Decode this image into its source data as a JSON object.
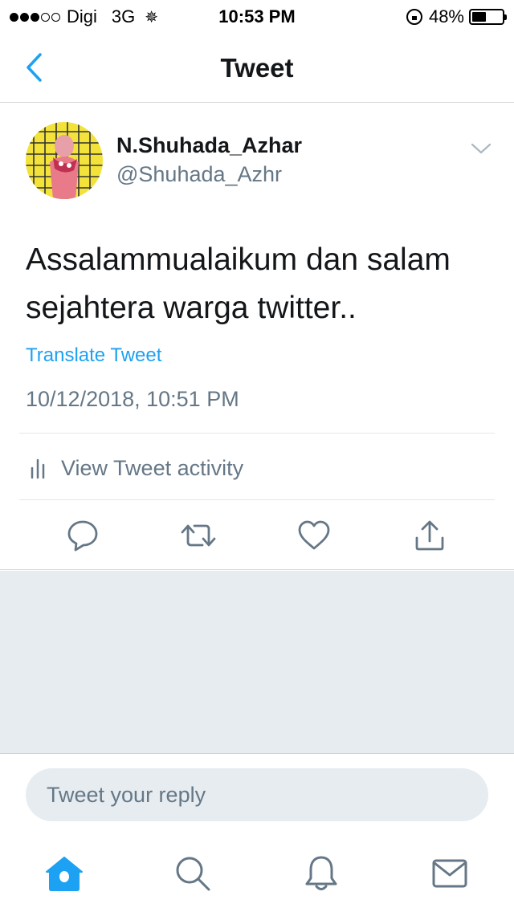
{
  "status_bar": {
    "carrier": "Digi",
    "network": "3G",
    "time": "10:53 PM",
    "battery": "48%",
    "battery_level": 0.48,
    "signal_bars_filled": 3,
    "signal_bars_total": 5
  },
  "nav": {
    "title": "Tweet",
    "back_icon": "chevron-left-icon"
  },
  "tweet": {
    "display_name": "N.Shuhada_Azhar",
    "username": "@Shuhada_Azhr",
    "text": "Assalammualaikum dan salam sejahtera warga twitter..",
    "translate_label": "Translate Tweet",
    "timestamp": "10/12/2018, 10:51 PM",
    "activity_label": "View Tweet activity"
  },
  "actions": [
    {
      "name": "reply",
      "icon": "comment-icon"
    },
    {
      "name": "retweet",
      "icon": "retweet-icon"
    },
    {
      "name": "like",
      "icon": "heart-icon"
    },
    {
      "name": "share",
      "icon": "share-icon"
    }
  ],
  "reply_box": {
    "placeholder": "Tweet your reply"
  },
  "tab_bar": [
    {
      "name": "home",
      "icon": "home-icon",
      "active": true
    },
    {
      "name": "search",
      "icon": "search-icon",
      "active": false
    },
    {
      "name": "notifications",
      "icon": "bell-icon",
      "active": false
    },
    {
      "name": "messages",
      "icon": "envelope-icon",
      "active": false
    }
  ],
  "colors": {
    "accent": "#1da1f2",
    "secondary_text": "#657786",
    "background_gray": "#e6ecf0",
    "icon_gray": "#657786"
  }
}
